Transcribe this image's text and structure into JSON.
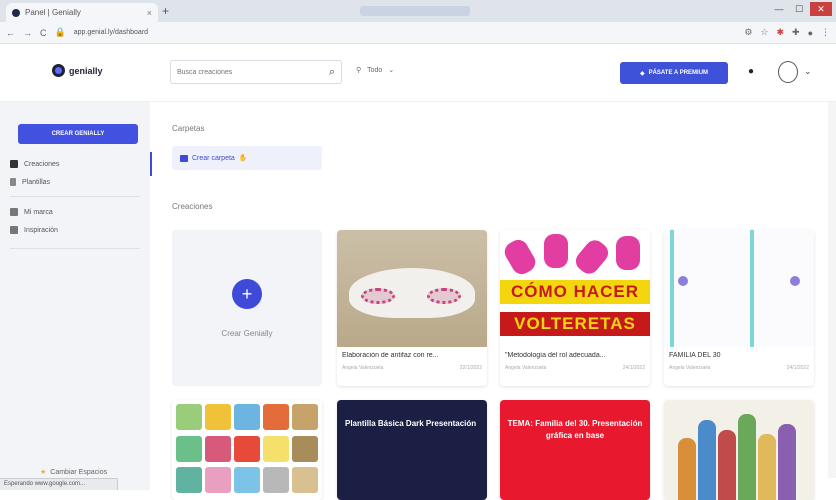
{
  "browser": {
    "tab_title": "Panel | Genially",
    "tab_close": "×",
    "new_tab": "+",
    "url": "app.genial.ly/dashboard",
    "window_controls": [
      "—",
      "☐",
      "✕"
    ]
  },
  "header": {
    "brand": "genially",
    "search_placeholder": "Busca creaciones",
    "filter_label": "Todo",
    "premium_label": "PÁSATE A PREMIUM"
  },
  "sidebar": {
    "create_button": "CREAR GENIALLY",
    "items": [
      {
        "label": "Creaciones",
        "icon": "grid-icon"
      },
      {
        "label": "Plantillas",
        "icon": "document-icon"
      },
      {
        "label": "Mi marca",
        "icon": "brand-icon"
      },
      {
        "label": "Inspiración",
        "icon": "inspiration-icon"
      }
    ],
    "footer": "Cambiar Espacios"
  },
  "main": {
    "folders_title": "Carpetas",
    "create_folder": "Crear carpeta",
    "creations_title": "Creaciones",
    "create_card_label": "Crear Genially",
    "cards": [
      {
        "title": "Elaboración de antifaz con re...",
        "author": "Angela Valenzuela",
        "date": "22/1/2022"
      },
      {
        "title": "\"Metodología del rol adecuada...",
        "author": "Angela Valenzuela",
        "date": "24/1/2022"
      },
      {
        "title": "FAMILIA DEL 30",
        "author": "Angela Valenzuela",
        "date": "24/1/2022"
      }
    ],
    "thumb_texts": {
      "volteretas_1": "CÓMO HACER",
      "volteretas_2": "VOLTERETAS",
      "dark_title": "Plantilla Básica Dark Presentación",
      "red_title": "TEMA: Familia del 30. Presentación gráfica en base"
    }
  },
  "status_bar": "Esperando www.google.com...",
  "colors": {
    "accent": "#3f4ad8",
    "premium": "#3d52d8",
    "sidebar_bg": "#f3f4f8",
    "dark_card": "#1c1f44",
    "red_card": "#e8182e"
  }
}
